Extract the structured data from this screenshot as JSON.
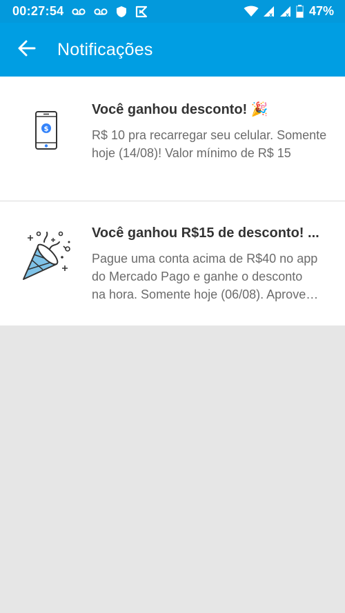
{
  "status_bar": {
    "time": "00:27:54",
    "battery": "47%",
    "icons": [
      "voicemail-icon",
      "voicemail-icon",
      "shield-icon",
      "app-icon",
      "wifi-icon",
      "signal-icon",
      "signal-icon",
      "battery-icon"
    ]
  },
  "app_bar": {
    "title": "Notificações",
    "back_icon": "arrow-left-icon"
  },
  "notifications": [
    {
      "title": "Você ganhou desconto!",
      "emoji": "🎉",
      "body": "R$ 10 pra recarregar seu celular. Somente hoje (14/08)! Valor mínimo de R$ 15",
      "icon": "phone-dollar-icon"
    },
    {
      "title": "Você ganhou R$15 de desconto! ...",
      "body_line1": "Pague uma conta acima de R$40 no app",
      "body_line2": "do Mercado Pago e ganhe o desconto",
      "body_line3": "na hora. Somente hoje (06/08). Aprove…",
      "icon": "party-popper-icon"
    }
  ],
  "colors": {
    "status_bar": "#0399dc",
    "app_bar": "#009ee3",
    "background": "#e6e6e6",
    "accent_icon": "#3483fa",
    "confetti_blue": "#7fc3e8"
  }
}
